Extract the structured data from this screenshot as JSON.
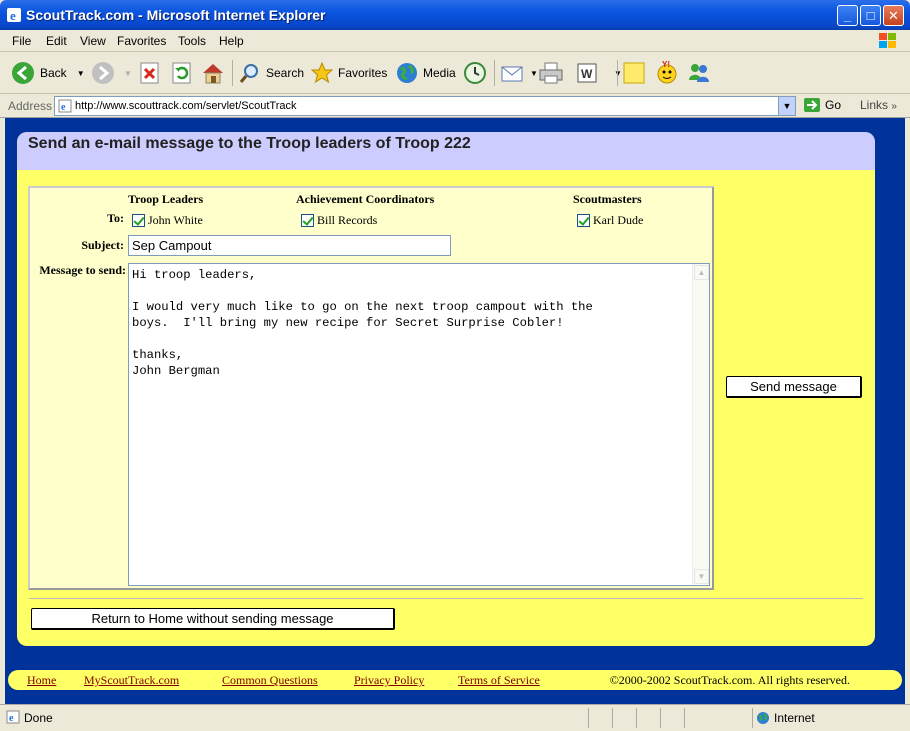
{
  "window": {
    "title": "ScoutTrack.com - Microsoft Internet Explorer"
  },
  "menu": [
    "File",
    "Edit",
    "View",
    "Favorites",
    "Tools",
    "Help"
  ],
  "toolbar": {
    "back": "Back",
    "search": "Search",
    "favorites": "Favorites",
    "media": "Media"
  },
  "address": {
    "label": "Address",
    "url": "http://www.scouttrack.com/servlet/ScoutTrack",
    "go": "Go",
    "links": "Links"
  },
  "page": {
    "heading": "Send an e-mail message to the Troop leaders of Troop 222",
    "columns": [
      "Troop Leaders",
      "Achievement Coordinators",
      "Scoutmasters"
    ],
    "to_label": "To:",
    "recipients": [
      {
        "name": "John White",
        "checked": true
      },
      {
        "name": "Bill Records",
        "checked": true
      },
      {
        "name": "Karl Dude",
        "checked": true
      }
    ],
    "subject_label": "Subject:",
    "subject_value": "Sep Campout",
    "message_label": "Message to send:",
    "message_body": "Hi troop leaders,\n\nI would very much like to go on the next troop campout with the\nboys.  I'll bring my new recipe for Secret Surprise Cobler!\n\nthanks,\nJohn Bergman",
    "send_button": "Send message",
    "return_button": "Return to Home without sending message"
  },
  "footer": {
    "links": [
      "Home",
      "MyScoutTrack.com",
      "Common Questions",
      "Privacy Policy",
      "Terms of Service"
    ],
    "copyright": "©2000-2002 ScoutTrack.com. All rights reserved."
  },
  "status": {
    "text": "Done",
    "zone": "Internet"
  },
  "colors": {
    "page_bg": "#003399",
    "card_bg": "#ffff66",
    "header_bg": "#ccccff",
    "form_bg": "#ffffcc",
    "link": "#800000"
  }
}
